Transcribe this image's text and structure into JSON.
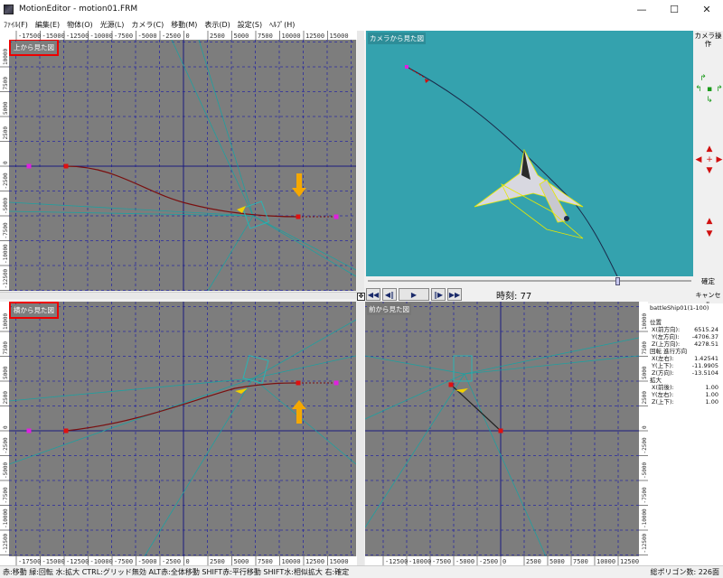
{
  "window": {
    "title": "MotionEditor - motion01.FRM",
    "controls": {
      "minimize": "—",
      "maximize": "☐",
      "close": "✕"
    }
  },
  "menu": [
    "ﾌｧｲﾙ(F)",
    "編集(E)",
    "物体(O)",
    "光源(L)",
    "カメラ(C)",
    "移動(M)",
    "表示(D)",
    "設定(S)",
    "ﾍﾙﾌﾟ(H)"
  ],
  "panes": {
    "top_view": {
      "label": "上から見た図",
      "x_ticks": [
        "-17500",
        "-15000",
        "-12500",
        "-10000",
        "-7500",
        "-5000",
        "-2500",
        "0",
        "2500",
        "5000",
        "7500",
        "10000",
        "12500",
        "15000"
      ],
      "y_ticks": [
        "10000",
        "7500",
        "5000",
        "2500",
        "0",
        "-2500",
        "-5000",
        "-7500",
        "-10000",
        "-12500"
      ]
    },
    "side_view": {
      "label": "横から見た図",
      "x_ticks": [
        "-17500",
        "-15000",
        "-12500",
        "-10000",
        "-7500",
        "-5000",
        "-2500",
        "0",
        "2500",
        "5000",
        "7500",
        "10000",
        "12500",
        "15000"
      ],
      "y_ticks": [
        "10000",
        "7500",
        "5000",
        "2500",
        "0",
        "-2500",
        "-5000",
        "-7500",
        "-10000",
        "-12500"
      ]
    },
    "front_view": {
      "label": "前から見た図",
      "x_ticks": [
        "-12500",
        "-10000",
        "-7500",
        "-5000",
        "-2500",
        "0",
        "2500",
        "5000",
        "7500",
        "10000",
        "12500"
      ],
      "y_ticks": [
        "10000",
        "7500",
        "5000",
        "2500",
        "0",
        "-2500",
        "-5000",
        "-7500",
        "-10000",
        "-12500"
      ]
    },
    "camera_view": {
      "label": "カメラから見た図"
    }
  },
  "camera_ops": {
    "label": "カメラ操作",
    "confirm": "確定",
    "cancel": "キャンセル"
  },
  "playback": {
    "time_label": "時刻:",
    "time_value": "77",
    "position": 0.77
  },
  "info": {
    "object": "battleShip01(1-100)",
    "position_title": "位置",
    "position": [
      {
        "k": "X(前方向):",
        "v": "6515.24"
      },
      {
        "k": "Y(左方向):",
        "v": "-4706.37"
      },
      {
        "k": "Z(上方向):",
        "v": "4278.51"
      }
    ],
    "rotation_title": "回転 進行方向",
    "rotation": [
      {
        "k": "X(左右):",
        "v": "1.42541"
      },
      {
        "k": "Y(上下):",
        "v": "-11.9905"
      },
      {
        "k": "Z(方向):",
        "v": "-13.5104"
      }
    ],
    "scale_title": "拡大",
    "scale": [
      {
        "k": "X(前後):",
        "v": "1.00"
      },
      {
        "k": "Y(左右):",
        "v": "1.00"
      },
      {
        "k": "Z(上下):",
        "v": "1.00"
      }
    ]
  },
  "status": {
    "hint": "赤:移動 緑:回転 水:拡大 CTRL:グリッド無効 ALT赤:全体移動 SHIFT赤:平行移動 SHIFT水:相似拡大 右:確定",
    "polygons": "総ポリゴン数: 226面"
  },
  "colors": {
    "grid_bg": "#7d7d7d",
    "grid_line": "#2a2aa0",
    "path": "#7a1010",
    "keypoint": "#e01010",
    "endpoint": "#e020e0",
    "camera_bg": "#34a2ae",
    "highlight_arrow": "#f5a800"
  }
}
